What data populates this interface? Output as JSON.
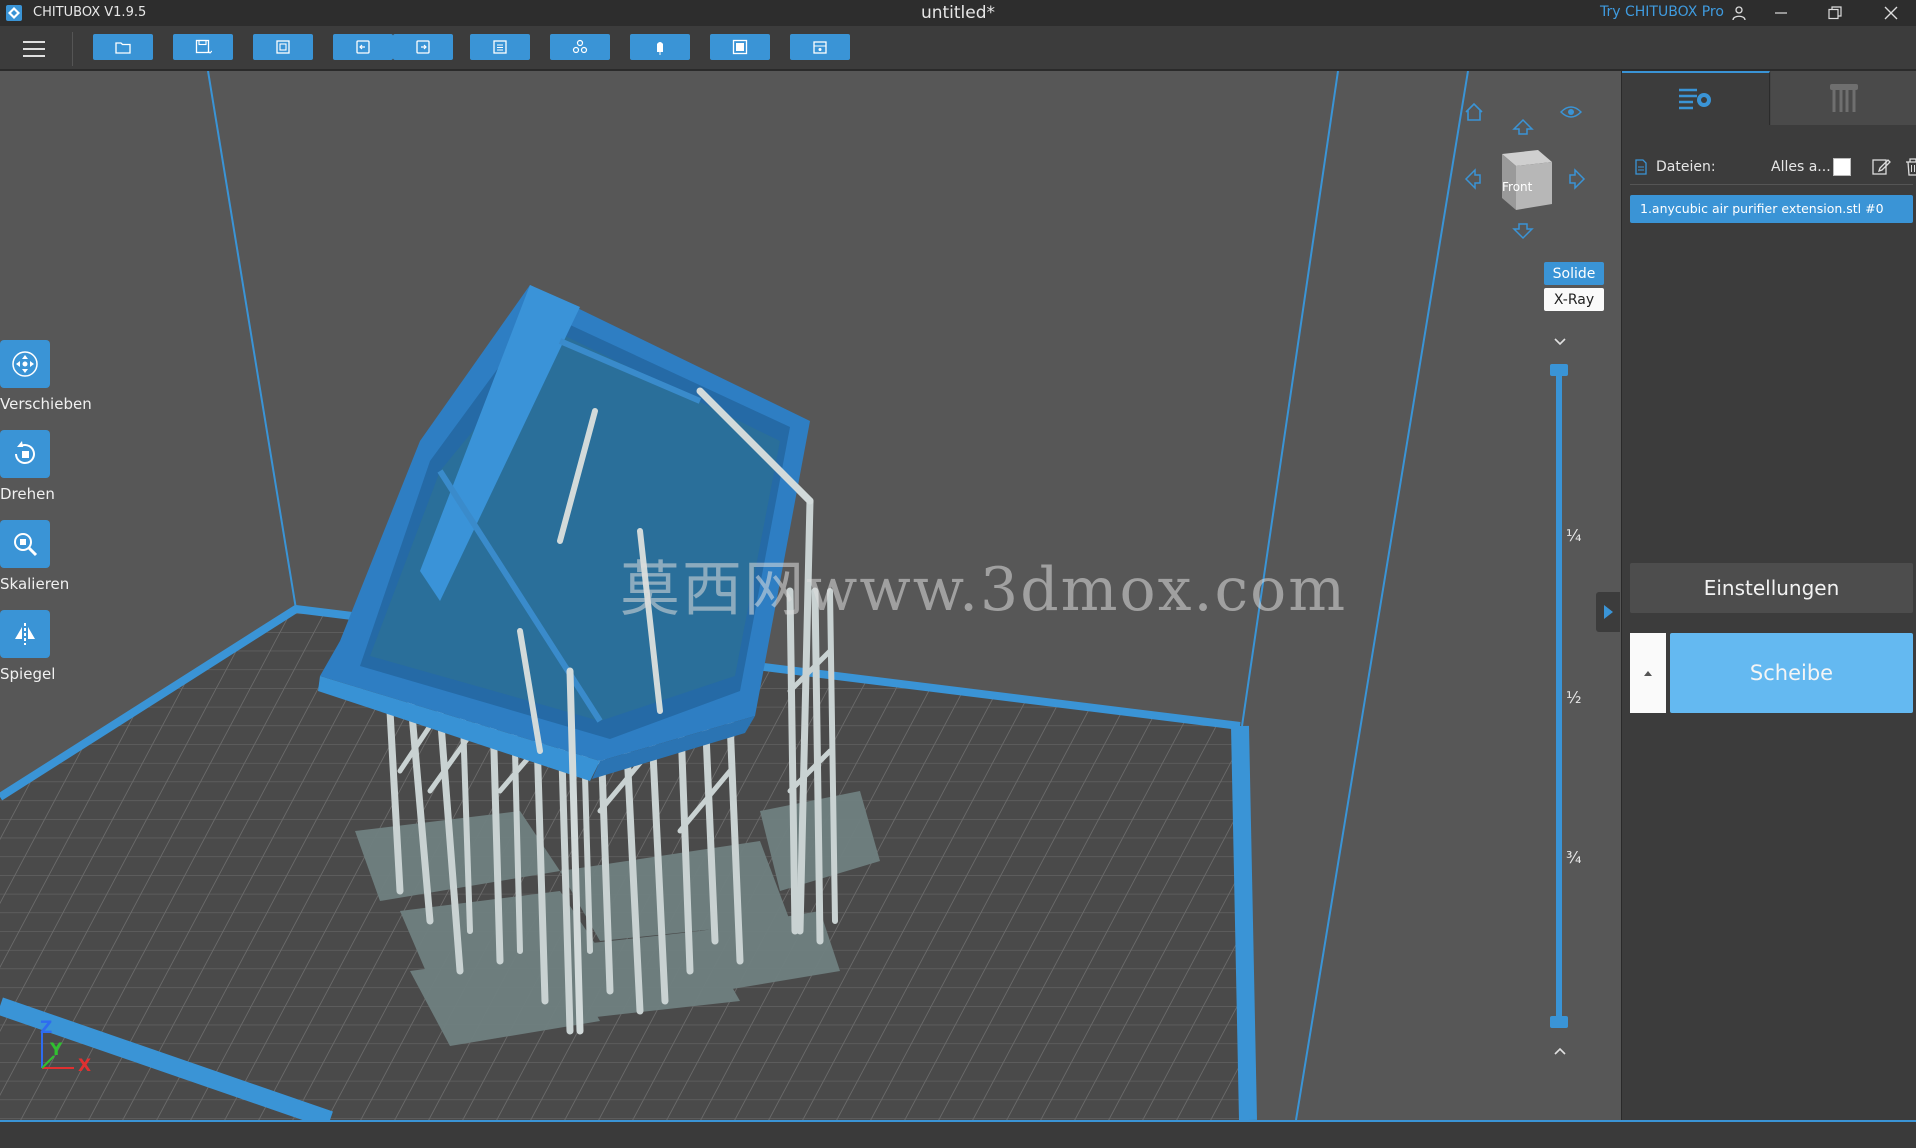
{
  "titlebar": {
    "app_name": "CHITUBOX V1.9.5",
    "doc_title": "untitled*",
    "pro_link": "Try CHITUBOX Pro"
  },
  "toolbar": {
    "buttons": [
      "open-folder-icon",
      "save-icon",
      "export-icon",
      "undo-icon",
      "redo-icon",
      "layers-icon",
      "arrange-icon",
      "support-icon",
      "hollow-icon",
      "drill-icon"
    ]
  },
  "left_tools": [
    {
      "label": "Verschieben",
      "icon": "move-icon"
    },
    {
      "label": "Drehen",
      "icon": "rotate-icon"
    },
    {
      "label": "Skalieren",
      "icon": "scale-icon"
    },
    {
      "label": "Spiegel",
      "icon": "mirror-icon"
    }
  ],
  "viewcube": {
    "face_label": "Front"
  },
  "render_modes": {
    "solid": "Solide",
    "xray": "X-Ray"
  },
  "layer_slider": {
    "ticks": [
      "¼",
      "½",
      "¾"
    ],
    "top_position": 0,
    "bottom_position": 1
  },
  "watermark": "莫西网www.3dmox.com",
  "panel": {
    "files_label": "Dateien:",
    "select_all_label": "Alles a...",
    "file_items": [
      "1.anycubic air purifier extension.stl #0"
    ],
    "settings_button": "Einstellungen",
    "slice_button": "Scheibe"
  },
  "axis": {
    "x": "X",
    "y": "Y",
    "z": "Z"
  },
  "colors": {
    "accent": "#3a94d6",
    "model": "#2f7fbf",
    "support": "#c9d2d2",
    "platform": "#4b4b4b",
    "background": "#575757"
  }
}
